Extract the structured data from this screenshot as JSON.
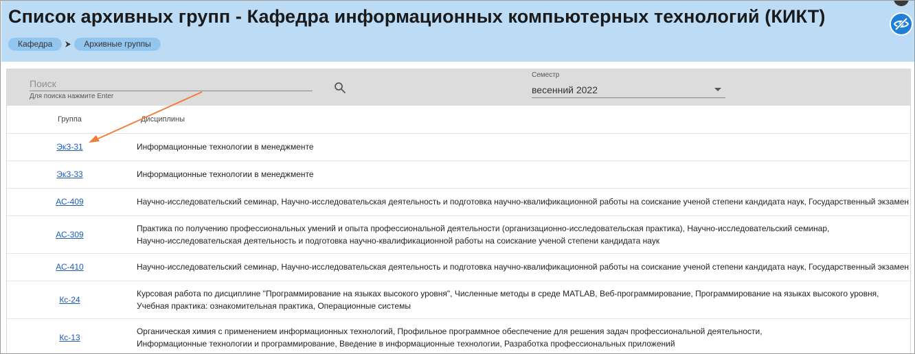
{
  "header": {
    "title": "Список архивных групп - Кафедра информационных компьютерных технологий (КИКТ)",
    "breadcrumb": [
      "Кафедра",
      "Архивные группы"
    ]
  },
  "toolbar": {
    "search_placeholder": "Поиск",
    "search_hint": "Для поиска нажмите Enter",
    "semester_label": "Семестр",
    "semester_value": "весенний 2022"
  },
  "table": {
    "headers": [
      "Группа",
      "Дисциплины"
    ],
    "rows": [
      {
        "group": "ЭкЗ-31",
        "lines": [
          "Информационные технологии в менеджменте"
        ]
      },
      {
        "group": "ЭкЗ-33",
        "lines": [
          "Информационные технологии в менеджменте"
        ]
      },
      {
        "group": "АС-409",
        "lines": [
          "Научно-исследовательский семинар,  Научно-исследовательская деятельность и подготовка научно-квалификационной работы на соискание ученой степени кандидата наук,  Государственный экзамен"
        ]
      },
      {
        "group": "АС-309",
        "lines": [
          "Практика по получению профессиональных умений и опыта профессиональной деятельности (организационно-исследовательская практика),  Научно-исследовательский семинар,",
          "Научно-исследовательская деятельность и подготовка научно-квалификационной работы на соискание ученой степени кандидата наук"
        ]
      },
      {
        "group": "АС-410",
        "lines": [
          "Научно-исследовательский семинар,  Научно-исследовательская деятельность и подготовка научно-квалификационной работы на соискание ученой степени кандидата наук,  Государственный экзамен"
        ]
      },
      {
        "group": "Кс-24",
        "lines": [
          "Курсовая работа по дисциплине \"Программирование на языках высокого уровня\",  Численные методы в среде MATLAB,  Веб-программирование,  Программирование на языках высокого уровня,",
          "Учебная практика: ознакомительная практика,  Операционные системы"
        ]
      },
      {
        "group": "Кс-13",
        "lines": [
          "Органическая химия с применением информационных технологий,  Профильное программное обеспечение для решения задач профессиональной деятельности,",
          "Информационные технологии и программирование,  Введение в информационные технологии,  Разработка профессиональных приложений"
        ]
      }
    ]
  },
  "colors": {
    "header_bg": "#bcdcf5",
    "crumb_bg": "#93c6ef",
    "toolbar_bg": "#dcdcdc",
    "link": "#1a5bbd",
    "accent_button": "#1e7fd8",
    "annotation_arrow": "#f07d3a"
  },
  "icons": {
    "search": "search-icon",
    "semester_dropdown": "chevron-down-icon",
    "breadcrumb_separator": "chevron-right-icon",
    "accessibility": "eye-slash-icon"
  }
}
